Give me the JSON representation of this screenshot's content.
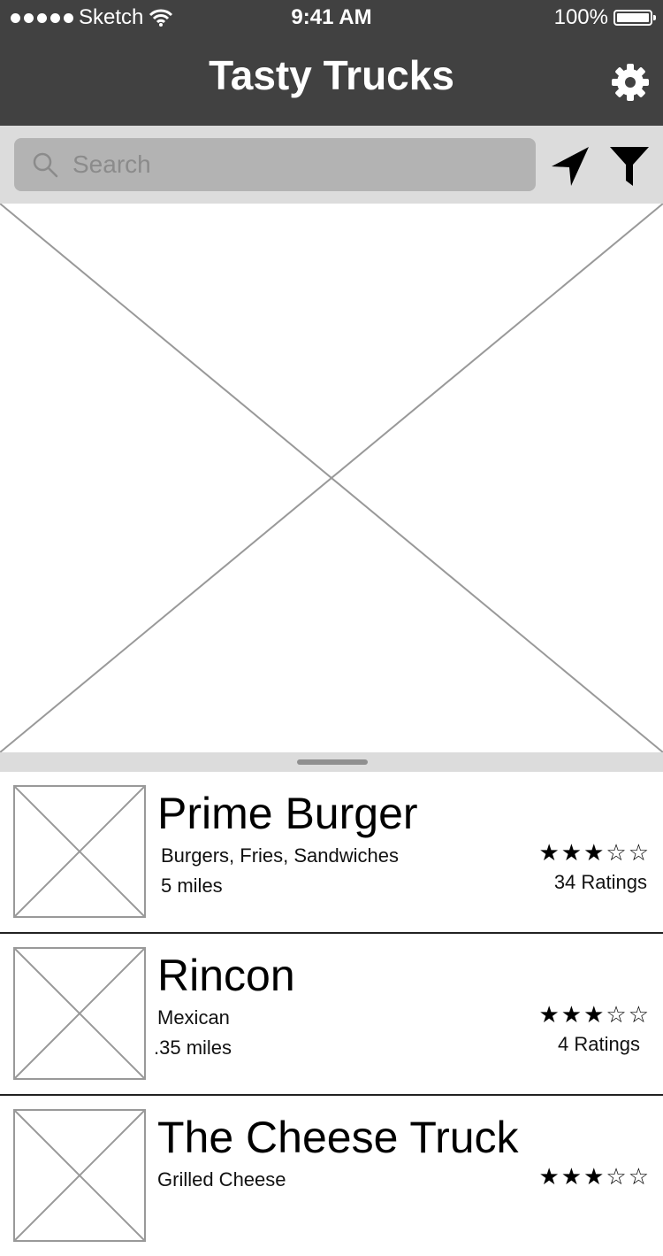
{
  "status_bar": {
    "carrier": "Sketch",
    "time": "9:41 AM",
    "battery": "100%"
  },
  "header": {
    "title": "Tasty Trucks",
    "settings_icon": "gear-icon"
  },
  "search": {
    "placeholder": "Search",
    "location_icon": "location-arrow-icon",
    "filter_icon": "filter-icon"
  },
  "trucks": [
    {
      "name": "Prime Burger",
      "categories": "Burgers, Fries, Sandwiches",
      "distance": "5 miles",
      "rating_stars": 3,
      "ratings_label": "34 Ratings"
    },
    {
      "name": "Rincon",
      "categories": "Mexican",
      "distance": ".35 miles",
      "rating_stars": 3,
      "ratings_label": "4 Ratings"
    },
    {
      "name": "The Cheese Truck",
      "categories": "Grilled Cheese",
      "distance": "",
      "rating_stars": 3,
      "ratings_label": ""
    }
  ],
  "colors": {
    "header_bg": "#414141",
    "search_bar_bg": "#dcdcdc",
    "search_input_bg": "#b3b3b3",
    "placeholder_stroke": "#999999"
  }
}
